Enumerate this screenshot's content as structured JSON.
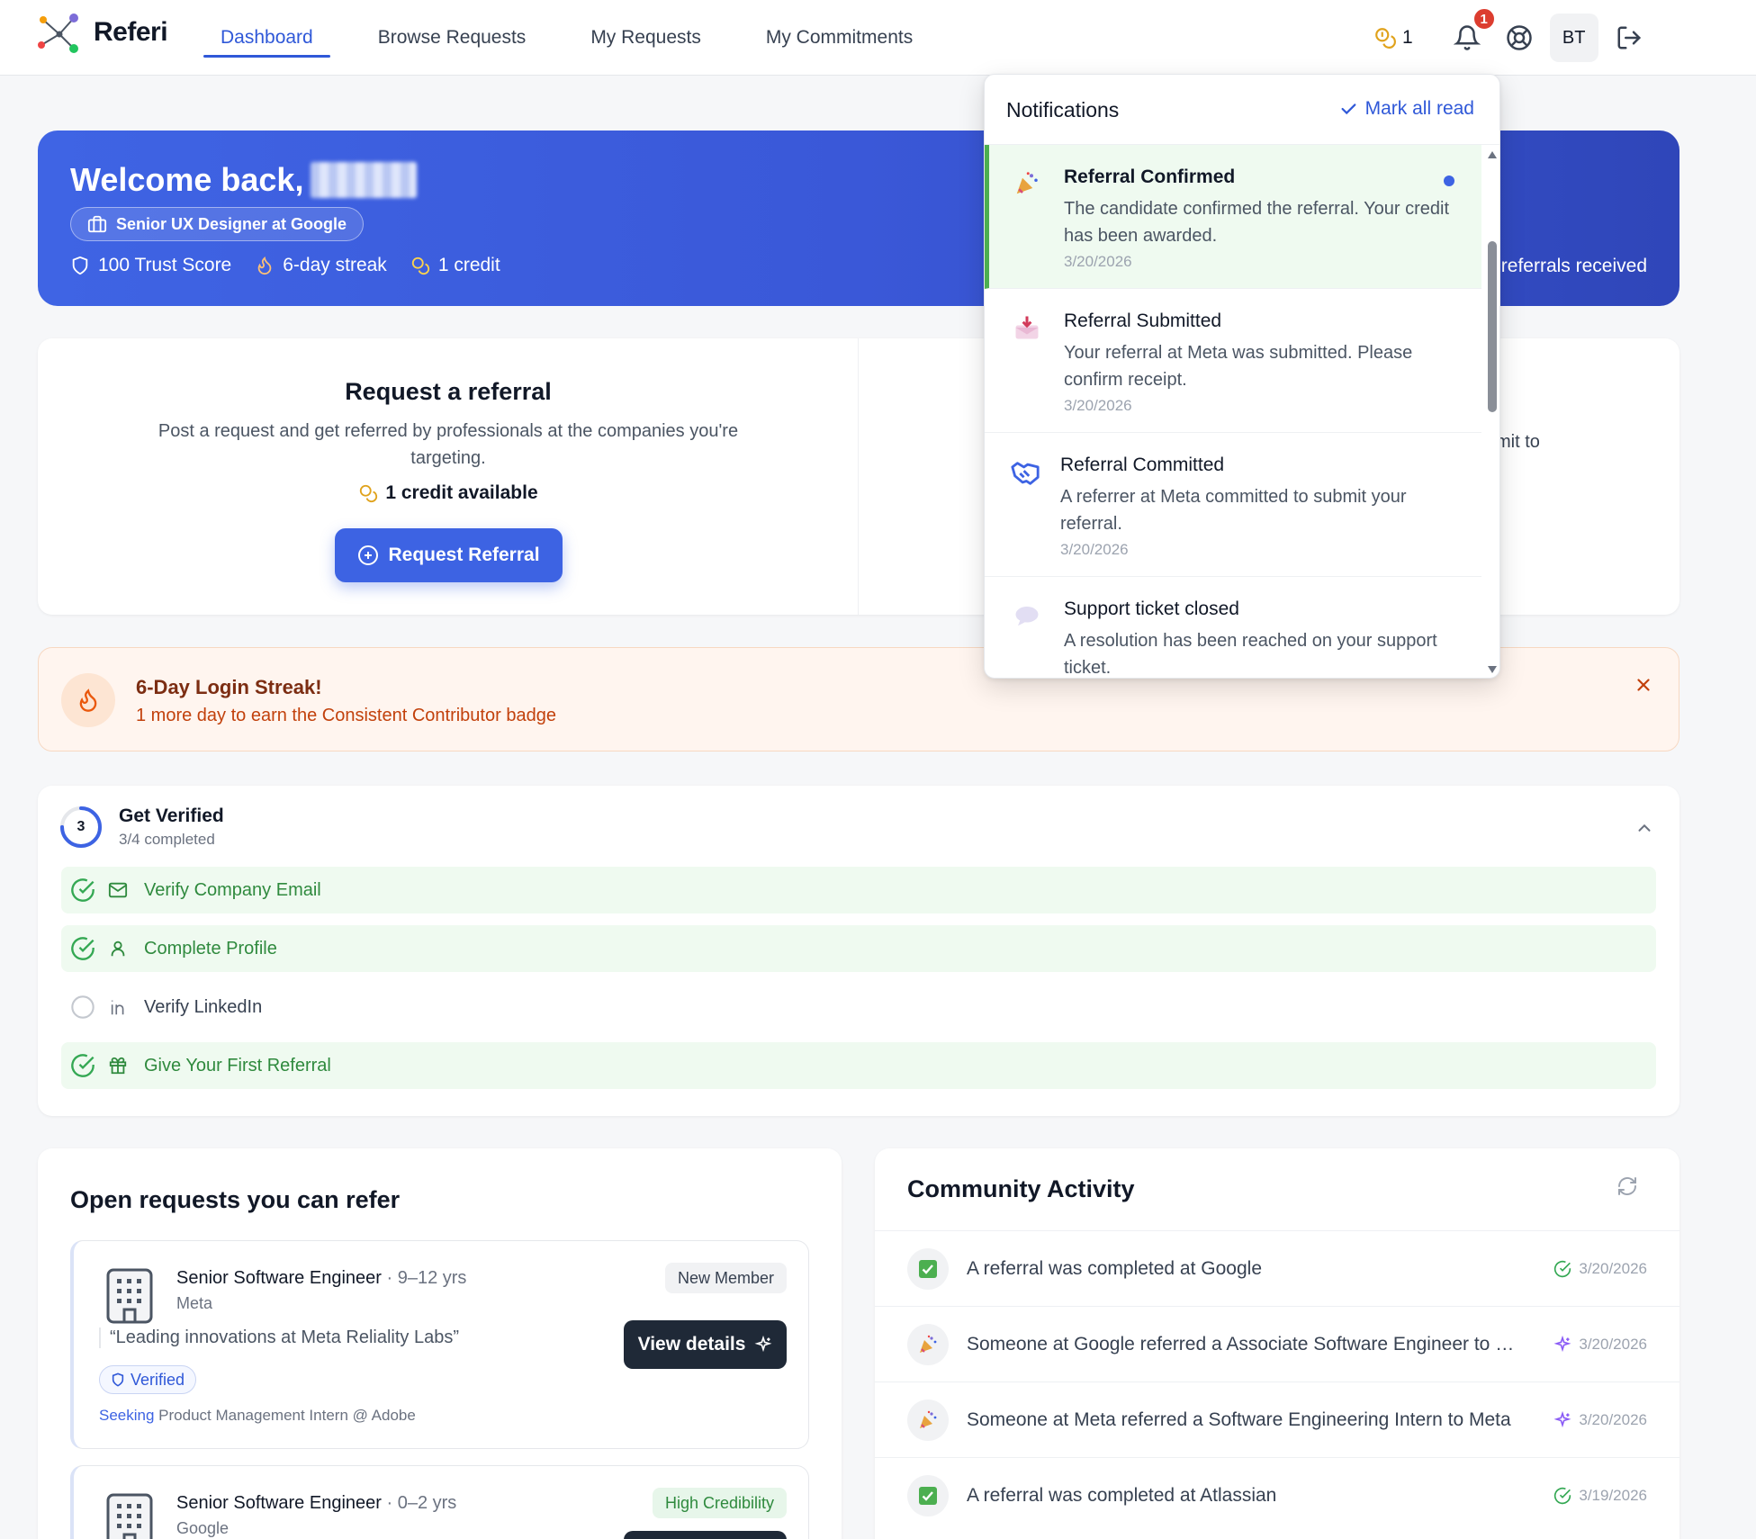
{
  "header": {
    "app_name": "Referi",
    "tabs": [
      {
        "label": "Dashboard",
        "active": true
      },
      {
        "label": "Browse Requests",
        "active": false
      },
      {
        "label": "My Requests",
        "active": false
      },
      {
        "label": "My Commitments",
        "active": false
      }
    ],
    "credits": "1",
    "notification_count": "1",
    "avatar_initials": "BT"
  },
  "hero": {
    "welcome": "Welcome back,",
    "role": "Senior UX Designer at Google",
    "trust_score": "100 Trust Score",
    "streak": "6-day streak",
    "credit": "1 credit",
    "right_text": "referrals received"
  },
  "request_card": {
    "title": "Request a referral",
    "description": "Post a request and get referred by professionals at the companies you're targeting.",
    "credit_available": "1 credit available",
    "button_label": "Request Referral",
    "right_line1": "mit to",
    "right_line2": "."
  },
  "streak_banner": {
    "title": "6-Day Login Streak!",
    "subtitle": "1 more day to earn the Consistent Contributor badge"
  },
  "verification": {
    "step_number": "3",
    "title": "Get Verified",
    "progress": "3/4 completed",
    "progress_fraction": 0.75,
    "steps": [
      {
        "label": "Verify Company Email",
        "done": true,
        "icon": "mail-icon"
      },
      {
        "label": "Complete Profile",
        "done": true,
        "icon": "user-icon"
      },
      {
        "label": "Verify LinkedIn",
        "done": false,
        "icon": "linkedin-icon"
      },
      {
        "label": "Give Your First Referral",
        "done": true,
        "icon": "gift-icon"
      }
    ]
  },
  "open_requests": {
    "title": "Open requests you can refer",
    "items": [
      {
        "title": "Senior Software Engineer",
        "years": "· 9–12 yrs",
        "company": "Meta",
        "tag": "New Member",
        "quote": "“Leading innovations at Meta Reliality Labs”",
        "verified": "Verified",
        "seeking_label": "Seeking",
        "seeking": "Product Management Intern @ Adobe",
        "button": "View details"
      },
      {
        "title": "Senior Software Engineer",
        "years": "· 0–2 yrs",
        "company": "Google",
        "tag": "High Credibility"
      }
    ]
  },
  "community": {
    "title": "Community Activity",
    "rows": [
      {
        "text": "A referral was completed at Google",
        "date": "3/20/2026",
        "kind": "completed"
      },
      {
        "text": "Someone at Google referred a Associate Software Engineer to Go...",
        "date": "3/20/2026",
        "kind": "referred"
      },
      {
        "text": "Someone at Meta referred a Software Engineering Intern to Meta",
        "date": "3/20/2026",
        "kind": "referred"
      },
      {
        "text": "A referral was completed at Atlassian",
        "date": "3/19/2026",
        "kind": "completed"
      }
    ]
  },
  "notifications": {
    "title": "Notifications",
    "mark_all": "Mark all read",
    "items": [
      {
        "title": "Referral Confirmed",
        "body": "The candidate confirmed the referral. Your credit has been awarded.",
        "date": "3/20/2026",
        "unread": true
      },
      {
        "title": "Referral Submitted",
        "body": "Your referral at Meta was submitted. Please confirm receipt.",
        "date": "3/20/2026",
        "unread": false
      },
      {
        "title": "Referral Committed",
        "body": "A referrer at Meta committed to submit your referral.",
        "date": "3/20/2026",
        "unread": false
      },
      {
        "title": "Support ticket closed",
        "body": "A resolution has been reached on your support ticket.",
        "date": "",
        "unread": false
      }
    ]
  },
  "colors": {
    "accent": "#3d63e3",
    "success": "#2f8a3e",
    "streak": "#c2410c",
    "badge": "#dc3d2f"
  }
}
